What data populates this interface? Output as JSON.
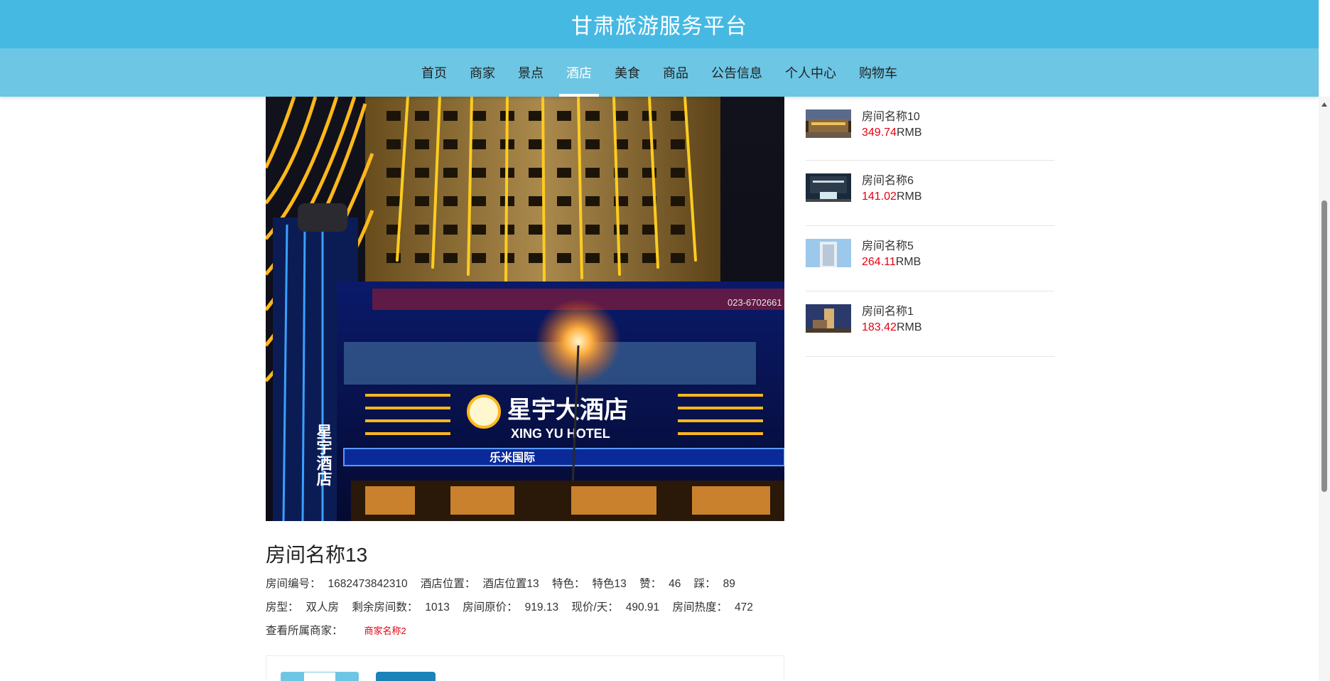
{
  "header": {
    "title": "甘肃旅游服务平台"
  },
  "nav": {
    "items": [
      {
        "label": "首页",
        "active": false
      },
      {
        "label": "商家",
        "active": false
      },
      {
        "label": "景点",
        "active": false
      },
      {
        "label": "酒店",
        "active": true
      },
      {
        "label": "美食",
        "active": false
      },
      {
        "label": "商品",
        "active": false
      },
      {
        "label": "公告信息",
        "active": false
      },
      {
        "label": "个人中心",
        "active": false
      },
      {
        "label": "购物车",
        "active": false
      }
    ]
  },
  "room": {
    "photo_sign_cn": "星宇大酒店",
    "photo_sign_en": "XING YU HOTEL",
    "photo_side_cn": "星宇酒店",
    "photo_banner": "乐米国际",
    "photo_phone": "023-6702661",
    "title": "房间名称13",
    "fields_line1": [
      {
        "label": "房间编号：",
        "value": "1682473842310"
      },
      {
        "label": "酒店位置：",
        "value": "酒店位置13"
      },
      {
        "label": "特色：",
        "value": "特色13"
      },
      {
        "label": "赞：",
        "value": "46"
      },
      {
        "label": "踩：",
        "value": "89"
      }
    ],
    "fields_line2": [
      {
        "label": "房型：",
        "value": "双人房"
      },
      {
        "label": "剩余房间数：",
        "value": "1013"
      },
      {
        "label": "房间原价：",
        "value": "919.13"
      },
      {
        "label": "现价/天：",
        "value": "490.91"
      },
      {
        "label": "房间热度：",
        "value": "472"
      }
    ],
    "merchant_label": "查看所属商家：",
    "merchant_name": "商家名称2"
  },
  "sidebar": {
    "items": [
      {
        "name": "房间名称10",
        "price": "349.74",
        "unit": "RMB"
      },
      {
        "name": "房间名称6",
        "price": "141.02",
        "unit": "RMB"
      },
      {
        "name": "房间名称5",
        "price": "264.11",
        "unit": "RMB"
      },
      {
        "name": "房间名称1",
        "price": "183.42",
        "unit": "RMB"
      }
    ]
  },
  "colors": {
    "header": "#46b9e3",
    "nav": "#6cc6e4",
    "price": "#e60012",
    "primary_button": "#1a83b9"
  }
}
